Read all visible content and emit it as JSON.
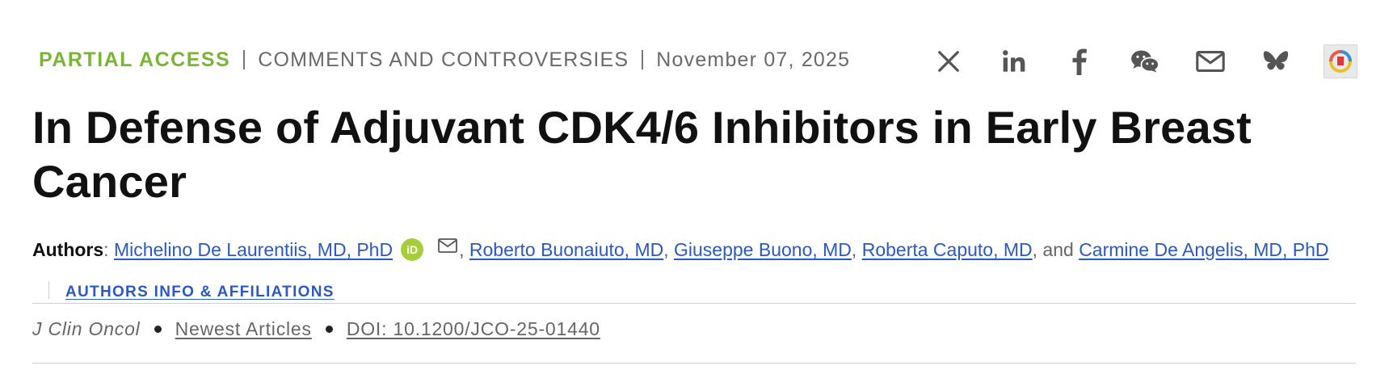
{
  "meta": {
    "access": "PARTIAL ACCESS",
    "category": "COMMENTS AND CONTROVERSIES",
    "date": "November 07, 2025"
  },
  "share_icons": [
    "x-icon",
    "linkedin-icon",
    "facebook-icon",
    "wechat-icon",
    "email-icon",
    "bluesky-icon",
    "altmetric-badge-icon"
  ],
  "title": "In Defense of Adjuvant CDK4/6 Inhibitors in Early Breast Cancer",
  "authors": {
    "label": "Authors",
    "colon": ":",
    "list": [
      "Michelino De Laurentiis, MD, PhD",
      "Roberto Buonaiuto, MD",
      "Giuseppe Buono, MD",
      "Roberta Caputo, MD",
      "Carmine De Angelis, MD, PhD"
    ],
    "separator": ",",
    "conjunction": ", and",
    "orcid_text": "iD",
    "affiliations_link": "AUTHORS INFO & AFFILIATIONS"
  },
  "citation": {
    "journal": "J Clin Oncol",
    "section": "Newest Articles",
    "doi": "DOI: 10.1200/JCO-25-01440"
  },
  "colors": {
    "access": "#7ab536",
    "link": "#2b59c3",
    "orcid": "#a6ce39",
    "muted": "#6a6a6a"
  }
}
